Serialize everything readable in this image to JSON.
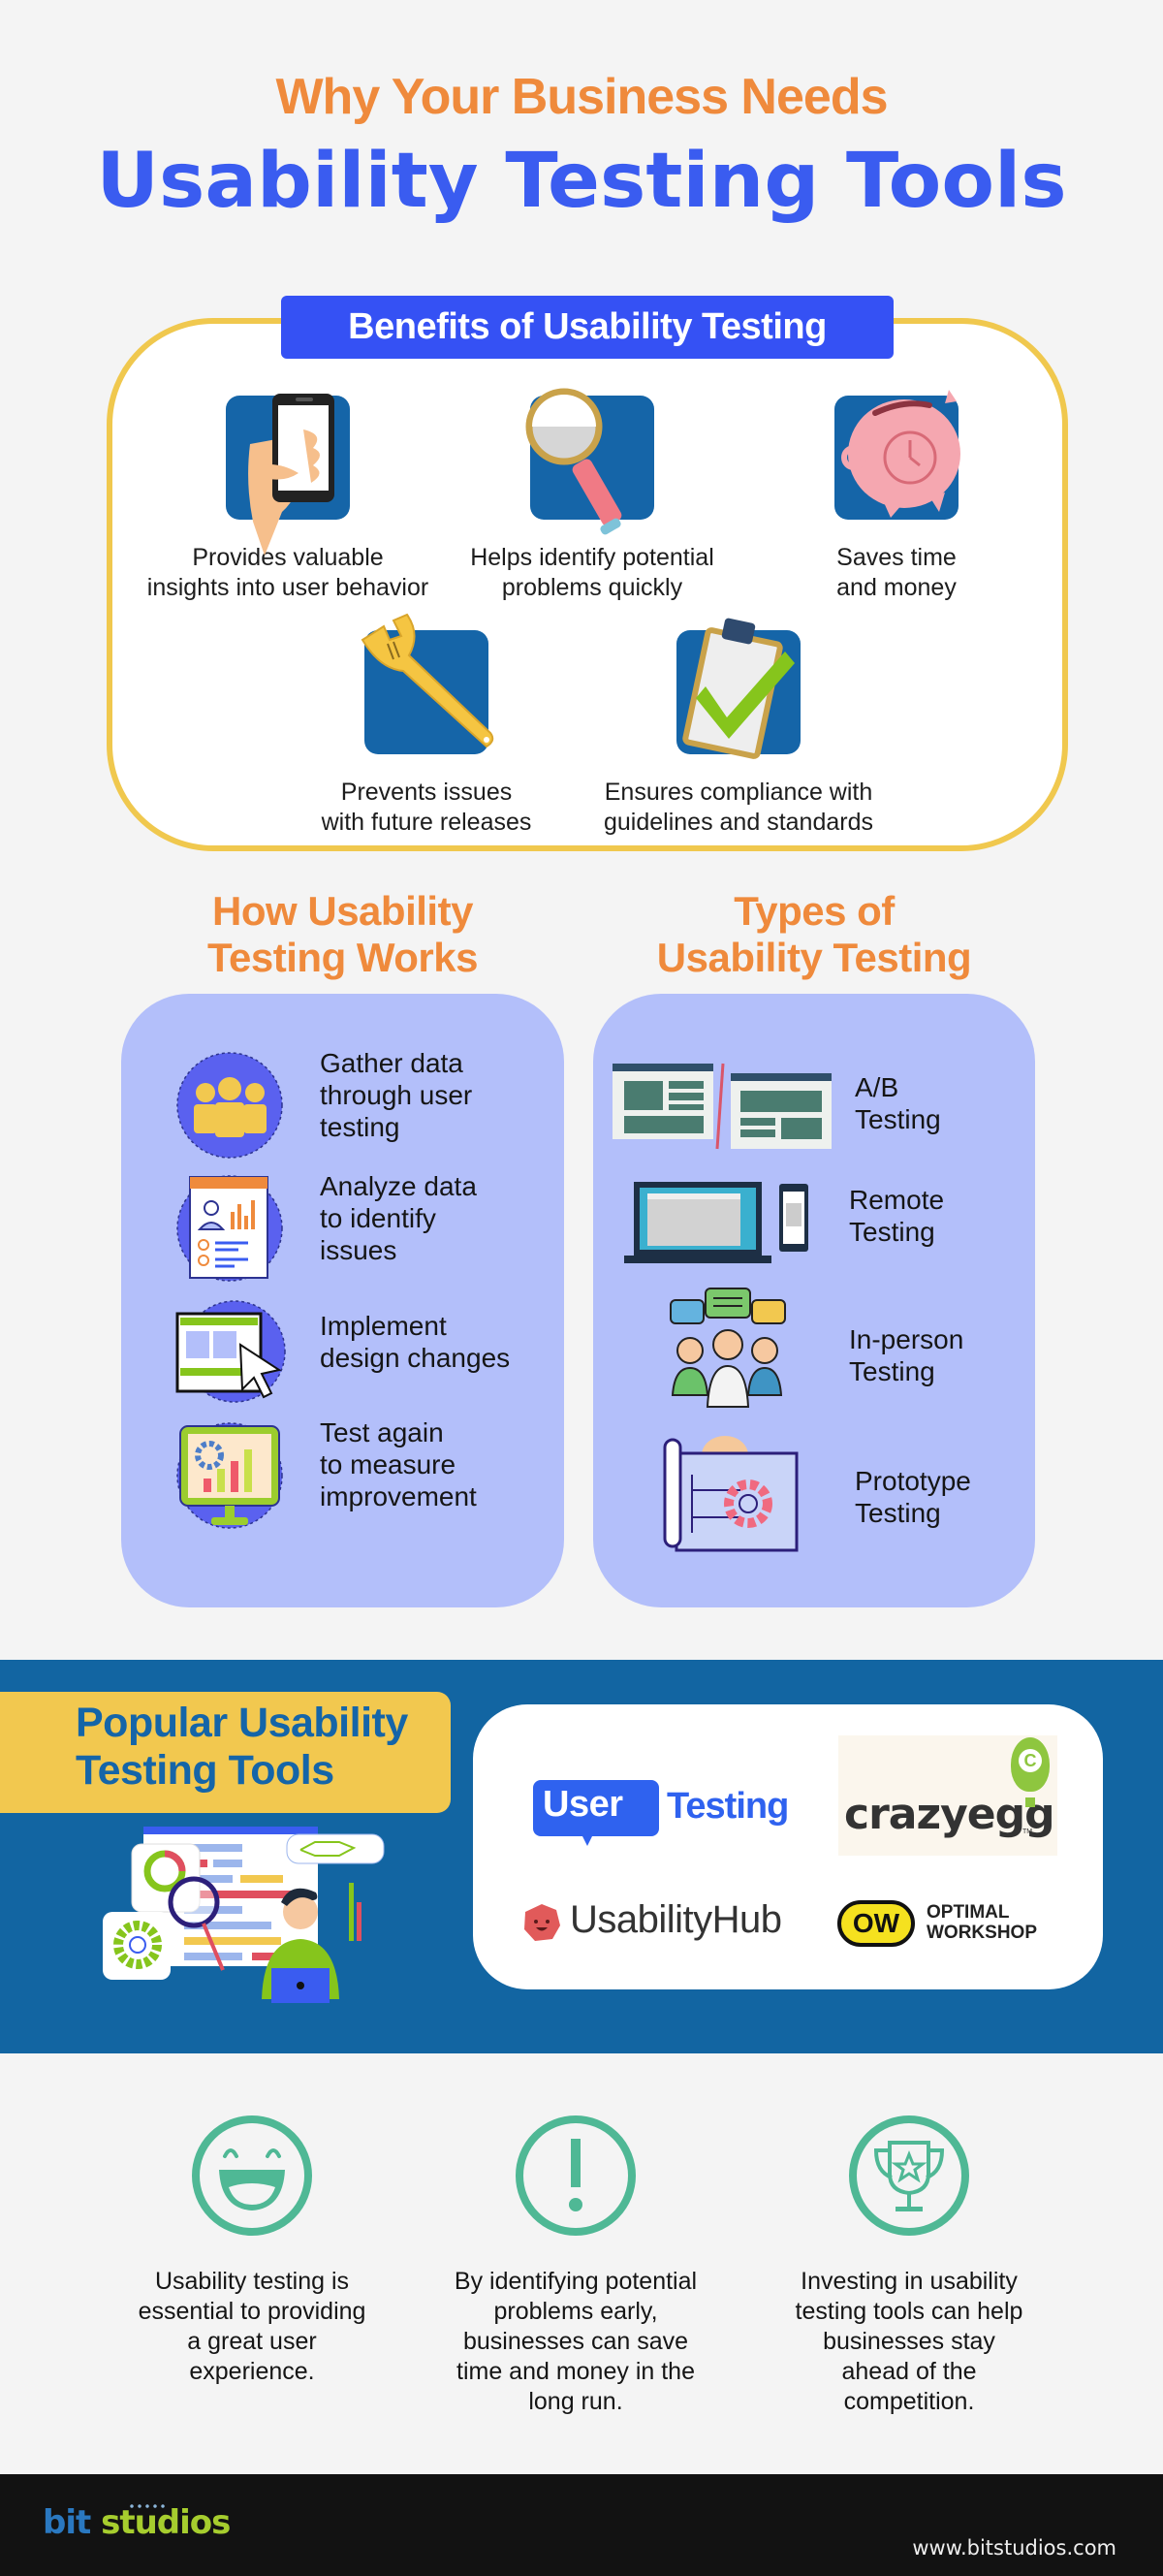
{
  "header": {
    "title_line1": "Why Your Business Needs",
    "title_line2": "Usability Testing Tools"
  },
  "benefits": {
    "heading": "Benefits of Usability Testing",
    "items": [
      {
        "icon": "hand-holding-phone-icon",
        "line1": "Provides valuable",
        "line2": "insights into user behavior"
      },
      {
        "icon": "magnifying-glass-icon",
        "line1": "Helps identify potential",
        "line2": "problems quickly"
      },
      {
        "icon": "piggy-bank-clock-icon",
        "line1": "Saves time",
        "line2": "and money"
      },
      {
        "icon": "wrench-icon",
        "line1": "Prevents issues",
        "line2": "with future releases"
      },
      {
        "icon": "clipboard-check-icon",
        "line1": "Ensures compliance with",
        "line2": "guidelines and standards"
      }
    ]
  },
  "how_it_works": {
    "heading_line1": "How Usability",
    "heading_line2": "Testing Works",
    "steps": [
      {
        "icon": "user-group-icon",
        "lines": [
          "Gather data",
          "through user",
          "testing"
        ]
      },
      {
        "icon": "report-analysis-icon",
        "lines": [
          "Analyze data",
          "to identify",
          "issues"
        ]
      },
      {
        "icon": "design-cursor-icon",
        "lines": [
          "Implement",
          "design changes"
        ]
      },
      {
        "icon": "monitor-chart-gear-icon",
        "lines": [
          "Test again",
          "to measure",
          "improvement"
        ]
      }
    ]
  },
  "types": {
    "heading_line1": "Types of",
    "heading_line2": "Usability Testing",
    "items": [
      {
        "icon": "ab-layout-icon",
        "lines": [
          "A/B",
          "Testing"
        ]
      },
      {
        "icon": "laptop-phone-icon",
        "lines": [
          "Remote",
          "Testing"
        ]
      },
      {
        "icon": "people-chat-icon",
        "lines": [
          "In-person",
          "Testing"
        ]
      },
      {
        "icon": "blueprint-gear-icon",
        "lines": [
          "Prototype",
          "Testing"
        ]
      }
    ]
  },
  "tools": {
    "heading_line1": "Popular Usability",
    "heading_line2": "Testing Tools",
    "logos": [
      {
        "name": "UserTesting",
        "part1": "User",
        "part2": "Testing"
      },
      {
        "name": "crazyegg",
        "text": "crazyegg",
        "tm": "TM",
        "balloon_letter": "C"
      },
      {
        "name": "UsabilityHub",
        "text": "UsabilityHub"
      },
      {
        "name": "Optimal Workshop",
        "badge": "OW",
        "line1": "OPTIMAL",
        "line2": "WORKSHOP"
      }
    ]
  },
  "points": [
    {
      "icon": "smiley-face-icon",
      "lines": [
        "Usability testing is",
        "essential to providing",
        "a great user",
        "experience."
      ]
    },
    {
      "icon": "exclamation-circle-icon",
      "lines": [
        "By identifying potential",
        "problems early,",
        "businesses can save",
        "time and money in the",
        "long run."
      ]
    },
    {
      "icon": "trophy-icon",
      "lines": [
        "Investing in usability",
        "testing tools can help",
        "businesses stay",
        "ahead of the",
        "competition."
      ]
    }
  ],
  "footer": {
    "brand_part1": "bit",
    "brand_part2": "studios",
    "website": "www.bitstudios.com"
  },
  "colors": {
    "orange": "#ef8a3c",
    "blue_title": "#3a5cf0",
    "header_blue": "#3551f4",
    "icon_blue": "#1565a8",
    "yellow": "#f0c84e",
    "panel_lavender": "#b3bffa",
    "band_blue": "#1265a2",
    "teal": "#4fb895",
    "footer_dark": "#121212"
  }
}
